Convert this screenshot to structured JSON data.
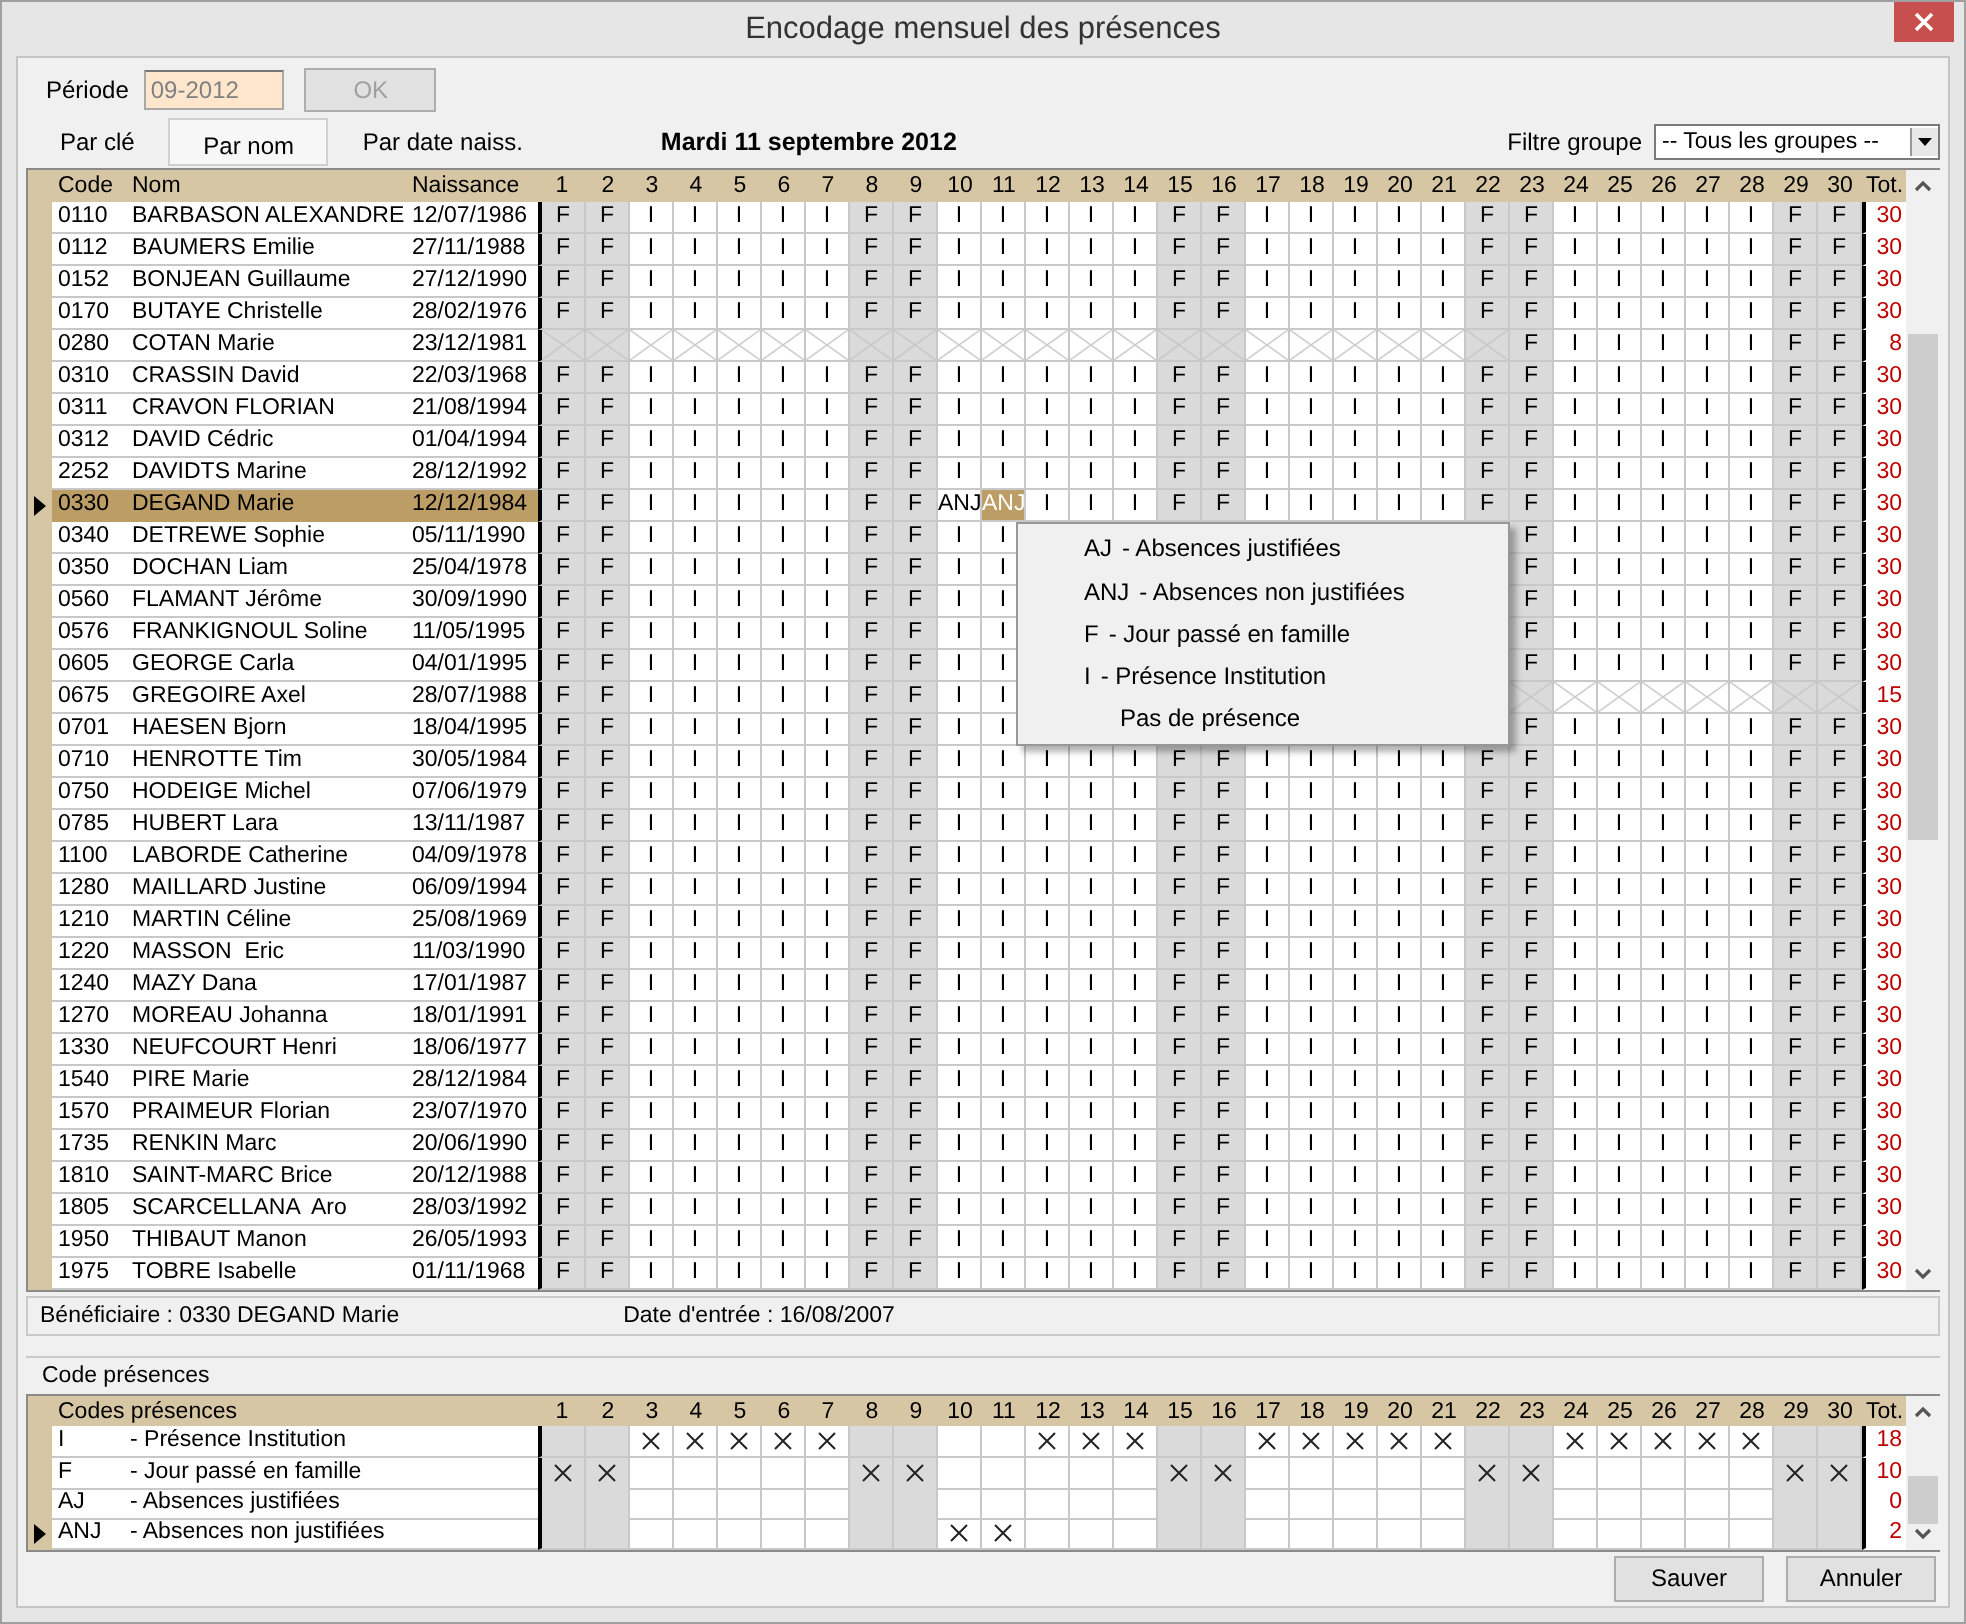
{
  "window": {
    "title": "Encodage mensuel des présences"
  },
  "period": {
    "label": "Période",
    "value": "09-2012",
    "disabled": true
  },
  "ok_button": {
    "label": "OK",
    "disabled": true
  },
  "sort_tabs": [
    {
      "label": "Par clé",
      "selected": false
    },
    {
      "label": "Par nom",
      "selected": true
    },
    {
      "label": "Par date naiss.",
      "selected": false
    }
  ],
  "current_date": "Mardi 11 septembre 2012",
  "group_filter": {
    "label": "Filtre groupe",
    "value": "-- Tous les groupes --"
  },
  "grid": {
    "columns": [
      "Code",
      "Nom",
      "Naissance"
    ],
    "total_label": "Tot.",
    "days": [
      {
        "label": "1",
        "weekend": true
      },
      {
        "label": "2",
        "weekend": true
      },
      {
        "label": "3",
        "weekend": false
      },
      {
        "label": "4",
        "weekend": false
      },
      {
        "label": "5",
        "weekend": false
      },
      {
        "label": "6",
        "weekend": false
      },
      {
        "label": "7",
        "weekend": false
      },
      {
        "label": "8",
        "weekend": true
      },
      {
        "label": "9",
        "weekend": true
      },
      {
        "label": "10",
        "weekend": false
      },
      {
        "label": "11",
        "weekend": false
      },
      {
        "label": "12",
        "weekend": false
      },
      {
        "label": "13",
        "weekend": false
      },
      {
        "label": "14",
        "weekend": false
      },
      {
        "label": "15",
        "weekend": true
      },
      {
        "label": "16",
        "weekend": true
      },
      {
        "label": "17",
        "weekend": false
      },
      {
        "label": "18",
        "weekend": false
      },
      {
        "label": "19",
        "weekend": false
      },
      {
        "label": "20",
        "weekend": false
      },
      {
        "label": "21",
        "weekend": false
      },
      {
        "label": "22",
        "weekend": true
      },
      {
        "label": "23",
        "weekend": true
      },
      {
        "label": "24",
        "weekend": false
      },
      {
        "label": "25",
        "weekend": false
      },
      {
        "label": "26",
        "weekend": false
      },
      {
        "label": "27",
        "weekend": false
      },
      {
        "label": "28",
        "weekend": false
      },
      {
        "label": "29",
        "weekend": true
      },
      {
        "label": "30",
        "weekend": true
      }
    ],
    "rows": [
      {
        "code": "0110",
        "name": "BARBASON ALEXANDRE",
        "birth": "12/07/1986",
        "selected": false,
        "total": "30",
        "cells": [
          "F",
          "F",
          "I",
          "I",
          "I",
          "I",
          "I",
          "F",
          "F",
          "I",
          "I",
          "I",
          "I",
          "I",
          "F",
          "F",
          "I",
          "I",
          "I",
          "I",
          "I",
          "F",
          "F",
          "I",
          "I",
          "I",
          "I",
          "I",
          "F",
          "F"
        ]
      },
      {
        "code": "0112",
        "name": "BAUMERS Emilie",
        "birth": "27/11/1988",
        "selected": false,
        "total": "30",
        "cells": [
          "F",
          "F",
          "I",
          "I",
          "I",
          "I",
          "I",
          "F",
          "F",
          "I",
          "I",
          "I",
          "I",
          "I",
          "F",
          "F",
          "I",
          "I",
          "I",
          "I",
          "I",
          "F",
          "F",
          "I",
          "I",
          "I",
          "I",
          "I",
          "F",
          "F"
        ]
      },
      {
        "code": "0152",
        "name": "BONJEAN Guillaume",
        "birth": "27/12/1990",
        "selected": false,
        "total": "30",
        "cells": [
          "F",
          "F",
          "I",
          "I",
          "I",
          "I",
          "I",
          "F",
          "F",
          "I",
          "I",
          "I",
          "I",
          "I",
          "F",
          "F",
          "I",
          "I",
          "I",
          "I",
          "I",
          "F",
          "F",
          "I",
          "I",
          "I",
          "I",
          "I",
          "F",
          "F"
        ]
      },
      {
        "code": "0170",
        "name": "BUTAYE Christelle",
        "birth": "28/02/1976",
        "selected": false,
        "total": "30",
        "cells": [
          "F",
          "F",
          "I",
          "I",
          "I",
          "I",
          "I",
          "F",
          "F",
          "I",
          "I",
          "I",
          "I",
          "I",
          "F",
          "F",
          "I",
          "I",
          "I",
          "I",
          "I",
          "F",
          "F",
          "I",
          "I",
          "I",
          "I",
          "I",
          "F",
          "F"
        ]
      },
      {
        "code": "0280",
        "name": "COTAN Marie",
        "birth": "23/12/1981",
        "selected": false,
        "total": "8",
        "cells": [
          null,
          null,
          null,
          null,
          null,
          null,
          null,
          null,
          null,
          null,
          null,
          null,
          null,
          null,
          null,
          null,
          null,
          null,
          null,
          null,
          null,
          null,
          "F",
          "I",
          "I",
          "I",
          "I",
          "I",
          "F",
          "F"
        ]
      },
      {
        "code": "0310",
        "name": "CRASSIN David",
        "birth": "22/03/1968",
        "selected": false,
        "total": "30",
        "cells": [
          "F",
          "F",
          "I",
          "I",
          "I",
          "I",
          "I",
          "F",
          "F",
          "I",
          "I",
          "I",
          "I",
          "I",
          "F",
          "F",
          "I",
          "I",
          "I",
          "I",
          "I",
          "F",
          "F",
          "I",
          "I",
          "I",
          "I",
          "I",
          "F",
          "F"
        ]
      },
      {
        "code": "0311",
        "name": "CRAVON FLORIAN",
        "birth": "21/08/1994",
        "selected": false,
        "total": "30",
        "cells": [
          "F",
          "F",
          "I",
          "I",
          "I",
          "I",
          "I",
          "F",
          "F",
          "I",
          "I",
          "I",
          "I",
          "I",
          "F",
          "F",
          "I",
          "I",
          "I",
          "I",
          "I",
          "F",
          "F",
          "I",
          "I",
          "I",
          "I",
          "I",
          "F",
          "F"
        ]
      },
      {
        "code": "0312",
        "name": "DAVID Cédric",
        "birth": "01/04/1994",
        "selected": false,
        "total": "30",
        "cells": [
          "F",
          "F",
          "I",
          "I",
          "I",
          "I",
          "I",
          "F",
          "F",
          "I",
          "I",
          "I",
          "I",
          "I",
          "F",
          "F",
          "I",
          "I",
          "I",
          "I",
          "I",
          "F",
          "F",
          "I",
          "I",
          "I",
          "I",
          "I",
          "F",
          "F"
        ]
      },
      {
        "code": "2252",
        "name": "DAVIDTS Marine",
        "birth": "28/12/1992",
        "selected": false,
        "total": "30",
        "cells": [
          "F",
          "F",
          "I",
          "I",
          "I",
          "I",
          "I",
          "F",
          "F",
          "I",
          "I",
          "I",
          "I",
          "I",
          "F",
          "F",
          "I",
          "I",
          "I",
          "I",
          "I",
          "F",
          "F",
          "I",
          "I",
          "I",
          "I",
          "I",
          "F",
          "F"
        ]
      },
      {
        "code": "0330",
        "name": "DEGAND Marie",
        "birth": "12/12/1984",
        "selected": true,
        "total": "30",
        "cells": [
          "F",
          "F",
          "I",
          "I",
          "I",
          "I",
          "I",
          "F",
          "F",
          "ANJ",
          {
            "value": "ANJ",
            "selected": true
          },
          "I",
          "I",
          "I",
          "F",
          "F",
          "I",
          "I",
          "I",
          "I",
          "I",
          "F",
          "F",
          "I",
          "I",
          "I",
          "I",
          "I",
          "F",
          "F"
        ]
      },
      {
        "code": "0340",
        "name": "DETREWE Sophie",
        "birth": "05/11/1990",
        "selected": false,
        "total": "30",
        "cells": [
          "F",
          "F",
          "I",
          "I",
          "I",
          "I",
          "I",
          "F",
          "F",
          "I",
          "I",
          null,
          null,
          null,
          null,
          null,
          null,
          null,
          null,
          null,
          null,
          null,
          "F",
          "I",
          "I",
          "I",
          "I",
          "I",
          "F",
          "F"
        ]
      },
      {
        "code": "0350",
        "name": "DOCHAN Liam",
        "birth": "25/04/1978",
        "selected": false,
        "total": "30",
        "cells": [
          "F",
          "F",
          "I",
          "I",
          "I",
          "I",
          "I",
          "F",
          "F",
          "I",
          "I",
          null,
          null,
          null,
          null,
          null,
          null,
          null,
          null,
          null,
          null,
          null,
          "F",
          "I",
          "I",
          "I",
          "I",
          "I",
          "F",
          "F"
        ]
      },
      {
        "code": "0560",
        "name": "FLAMANT Jérôme",
        "birth": "30/09/1990",
        "selected": false,
        "total": "30",
        "cells": [
          "F",
          "F",
          "I",
          "I",
          "I",
          "I",
          "I",
          "F",
          "F",
          "I",
          "I",
          null,
          null,
          null,
          null,
          null,
          null,
          null,
          null,
          null,
          null,
          null,
          "F",
          "I",
          "I",
          "I",
          "I",
          "I",
          "F",
          "F"
        ]
      },
      {
        "code": "0576",
        "name": "FRANKIGNOUL Soline",
        "birth": "11/05/1995",
        "selected": false,
        "total": "30",
        "cells": [
          "F",
          "F",
          "I",
          "I",
          "I",
          "I",
          "I",
          "F",
          "F",
          "I",
          "I",
          null,
          null,
          null,
          null,
          null,
          null,
          null,
          null,
          null,
          null,
          null,
          "F",
          "I",
          "I",
          "I",
          "I",
          "I",
          "F",
          "F"
        ]
      },
      {
        "code": "0605",
        "name": "GEORGE Carla",
        "birth": "04/01/1995",
        "selected": false,
        "total": "30",
        "cells": [
          "F",
          "F",
          "I",
          "I",
          "I",
          "I",
          "I",
          "F",
          "F",
          "I",
          "I",
          null,
          null,
          null,
          null,
          null,
          null,
          null,
          null,
          null,
          null,
          null,
          "F",
          "I",
          "I",
          "I",
          "I",
          "I",
          "F",
          "F"
        ]
      },
      {
        "code": "0675",
        "name": "GREGOIRE Axel",
        "birth": "28/07/1988",
        "selected": false,
        "total": "15",
        "cells": [
          "F",
          "F",
          "I",
          "I",
          "I",
          "I",
          "I",
          "F",
          "F",
          "I",
          "I",
          null,
          null,
          null,
          null,
          null,
          null,
          null,
          null,
          null,
          null,
          null,
          null,
          null,
          null,
          null,
          null,
          null,
          null,
          null
        ]
      },
      {
        "code": "0701",
        "name": "HAESEN Bjorn",
        "birth": "18/04/1995",
        "selected": false,
        "total": "30",
        "cells": [
          "F",
          "F",
          "I",
          "I",
          "I",
          "I",
          "I",
          "F",
          "F",
          "I",
          "I",
          null,
          null,
          null,
          null,
          null,
          null,
          null,
          null,
          null,
          null,
          null,
          "F",
          "I",
          "I",
          "I",
          "I",
          "I",
          "F",
          "F"
        ]
      },
      {
        "code": "0710",
        "name": "HENROTTE Tim",
        "birth": "30/05/1984",
        "selected": false,
        "total": "30",
        "cells": [
          "F",
          "F",
          "I",
          "I",
          "I",
          "I",
          "I",
          "F",
          "F",
          "I",
          "I",
          "I",
          "I",
          "I",
          "F",
          "F",
          "I",
          "I",
          "I",
          "I",
          "I",
          "F",
          "F",
          "I",
          "I",
          "I",
          "I",
          "I",
          "F",
          "F"
        ]
      },
      {
        "code": "0750",
        "name": "HODEIGE Michel",
        "birth": "07/06/1979",
        "selected": false,
        "total": "30",
        "cells": [
          "F",
          "F",
          "I",
          "I",
          "I",
          "I",
          "I",
          "F",
          "F",
          "I",
          "I",
          "I",
          "I",
          "I",
          "F",
          "F",
          "I",
          "I",
          "I",
          "I",
          "I",
          "F",
          "F",
          "I",
          "I",
          "I",
          "I",
          "I",
          "F",
          "F"
        ]
      },
      {
        "code": "0785",
        "name": "HUBERT Lara",
        "birth": "13/11/1987",
        "selected": false,
        "total": "30",
        "cells": [
          "F",
          "F",
          "I",
          "I",
          "I",
          "I",
          "I",
          "F",
          "F",
          "I",
          "I",
          "I",
          "I",
          "I",
          "F",
          "F",
          "I",
          "I",
          "I",
          "I",
          "I",
          "F",
          "F",
          "I",
          "I",
          "I",
          "I",
          "I",
          "F",
          "F"
        ]
      },
      {
        "code": "1100",
        "name": "LABORDE Catherine",
        "birth": "04/09/1978",
        "selected": false,
        "total": "30",
        "cells": [
          "F",
          "F",
          "I",
          "I",
          "I",
          "I",
          "I",
          "F",
          "F",
          "I",
          "I",
          "I",
          "I",
          "I",
          "F",
          "F",
          "I",
          "I",
          "I",
          "I",
          "I",
          "F",
          "F",
          "I",
          "I",
          "I",
          "I",
          "I",
          "F",
          "F"
        ]
      },
      {
        "code": "1280",
        "name": "MAILLARD Justine",
        "birth": "06/09/1994",
        "selected": false,
        "total": "30",
        "cells": [
          "F",
          "F",
          "I",
          "I",
          "I",
          "I",
          "I",
          "F",
          "F",
          "I",
          "I",
          "I",
          "I",
          "I",
          "F",
          "F",
          "I",
          "I",
          "I",
          "I",
          "I",
          "F",
          "F",
          "I",
          "I",
          "I",
          "I",
          "I",
          "F",
          "F"
        ]
      },
      {
        "code": "1210",
        "name": "MARTIN Céline",
        "birth": "25/08/1969",
        "selected": false,
        "total": "30",
        "cells": [
          "F",
          "F",
          "I",
          "I",
          "I",
          "I",
          "I",
          "F",
          "F",
          "I",
          "I",
          "I",
          "I",
          "I",
          "F",
          "F",
          "I",
          "I",
          "I",
          "I",
          "I",
          "F",
          "F",
          "I",
          "I",
          "I",
          "I",
          "I",
          "F",
          "F"
        ]
      },
      {
        "code": "1220",
        "name": "MASSON  Eric",
        "birth": "11/03/1990",
        "selected": false,
        "total": "30",
        "cells": [
          "F",
          "F",
          "I",
          "I",
          "I",
          "I",
          "I",
          "F",
          "F",
          "I",
          "I",
          "I",
          "I",
          "I",
          "F",
          "F",
          "I",
          "I",
          "I",
          "I",
          "I",
          "F",
          "F",
          "I",
          "I",
          "I",
          "I",
          "I",
          "F",
          "F"
        ]
      },
      {
        "code": "1240",
        "name": "MAZY Dana",
        "birth": "17/01/1987",
        "selected": false,
        "total": "30",
        "cells": [
          "F",
          "F",
          "I",
          "I",
          "I",
          "I",
          "I",
          "F",
          "F",
          "I",
          "I",
          "I",
          "I",
          "I",
          "F",
          "F",
          "I",
          "I",
          "I",
          "I",
          "I",
          "F",
          "F",
          "I",
          "I",
          "I",
          "I",
          "I",
          "F",
          "F"
        ]
      },
      {
        "code": "1270",
        "name": "MOREAU Johanna",
        "birth": "18/01/1991",
        "selected": false,
        "total": "30",
        "cells": [
          "F",
          "F",
          "I",
          "I",
          "I",
          "I",
          "I",
          "F",
          "F",
          "I",
          "I",
          "I",
          "I",
          "I",
          "F",
          "F",
          "I",
          "I",
          "I",
          "I",
          "I",
          "F",
          "F",
          "I",
          "I",
          "I",
          "I",
          "I",
          "F",
          "F"
        ]
      },
      {
        "code": "1330",
        "name": "NEUFCOURT Henri",
        "birth": "18/06/1977",
        "selected": false,
        "total": "30",
        "cells": [
          "F",
          "F",
          "I",
          "I",
          "I",
          "I",
          "I",
          "F",
          "F",
          "I",
          "I",
          "I",
          "I",
          "I",
          "F",
          "F",
          "I",
          "I",
          "I",
          "I",
          "I",
          "F",
          "F",
          "I",
          "I",
          "I",
          "I",
          "I",
          "F",
          "F"
        ]
      },
      {
        "code": "1540",
        "name": "PIRE Marie",
        "birth": "28/12/1984",
        "selected": false,
        "total": "30",
        "cells": [
          "F",
          "F",
          "I",
          "I",
          "I",
          "I",
          "I",
          "F",
          "F",
          "I",
          "I",
          "I",
          "I",
          "I",
          "F",
          "F",
          "I",
          "I",
          "I",
          "I",
          "I",
          "F",
          "F",
          "I",
          "I",
          "I",
          "I",
          "I",
          "F",
          "F"
        ]
      },
      {
        "code": "1570",
        "name": "PRAIMEUR Florian",
        "birth": "23/07/1970",
        "selected": false,
        "total": "30",
        "cells": [
          "F",
          "F",
          "I",
          "I",
          "I",
          "I",
          "I",
          "F",
          "F",
          "I",
          "I",
          "I",
          "I",
          "I",
          "F",
          "F",
          "I",
          "I",
          "I",
          "I",
          "I",
          "F",
          "F",
          "I",
          "I",
          "I",
          "I",
          "I",
          "F",
          "F"
        ]
      },
      {
        "code": "1735",
        "name": "RENKIN Marc",
        "birth": "20/06/1990",
        "selected": false,
        "total": "30",
        "cells": [
          "F",
          "F",
          "I",
          "I",
          "I",
          "I",
          "I",
          "F",
          "F",
          "I",
          "I",
          "I",
          "I",
          "I",
          "F",
          "F",
          "I",
          "I",
          "I",
          "I",
          "I",
          "F",
          "F",
          "I",
          "I",
          "I",
          "I",
          "I",
          "F",
          "F"
        ]
      },
      {
        "code": "1810",
        "name": "SAINT-MARC Brice",
        "birth": "20/12/1988",
        "selected": false,
        "total": "30",
        "cells": [
          "F",
          "F",
          "I",
          "I",
          "I",
          "I",
          "I",
          "F",
          "F",
          "I",
          "I",
          "I",
          "I",
          "I",
          "F",
          "F",
          "I",
          "I",
          "I",
          "I",
          "I",
          "F",
          "F",
          "I",
          "I",
          "I",
          "I",
          "I",
          "F",
          "F"
        ]
      },
      {
        "code": "1805",
        "name": "SCARCELLANA  Aro",
        "birth": "28/03/1992",
        "selected": false,
        "total": "30",
        "cells": [
          "F",
          "F",
          "I",
          "I",
          "I",
          "I",
          "I",
          "F",
          "F",
          "I",
          "I",
          "I",
          "I",
          "I",
          "F",
          "F",
          "I",
          "I",
          "I",
          "I",
          "I",
          "F",
          "F",
          "I",
          "I",
          "I",
          "I",
          "I",
          "F",
          "F"
        ]
      },
      {
        "code": "1950",
        "name": "THIBAUT Manon",
        "birth": "26/05/1993",
        "selected": false,
        "total": "30",
        "cells": [
          "F",
          "F",
          "I",
          "I",
          "I",
          "I",
          "I",
          "F",
          "F",
          "I",
          "I",
          "I",
          "I",
          "I",
          "F",
          "F",
          "I",
          "I",
          "I",
          "I",
          "I",
          "F",
          "F",
          "I",
          "I",
          "I",
          "I",
          "I",
          "F",
          "F"
        ]
      },
      {
        "code": "1975",
        "name": "TOBRE Isabelle",
        "birth": "01/11/1968",
        "selected": false,
        "total": "30",
        "cells": [
          "F",
          "F",
          "I",
          "I",
          "I",
          "I",
          "I",
          "F",
          "F",
          "I",
          "I",
          "I",
          "I",
          "I",
          "F",
          "F",
          "I",
          "I",
          "I",
          "I",
          "I",
          "F",
          "F",
          "I",
          "I",
          "I",
          "I",
          "I",
          "F",
          "F"
        ]
      }
    ]
  },
  "context_menu": {
    "items": [
      {
        "code": "AJ",
        "label": "- Absences justifiées"
      },
      {
        "code": "ANJ",
        "label": "- Absences non justifiées"
      },
      {
        "code": "F",
        "label": "- Jour passé en famille"
      },
      {
        "code": "I",
        "label": "- Présence Institution"
      },
      {
        "label": "Pas de présence"
      }
    ]
  },
  "info": {
    "beneficiary": "Bénéficiaire : 0330 DEGAND Marie",
    "entry_date": "Date d'entrée : 16/08/2007"
  },
  "codes_panel": {
    "title": "Code présences",
    "header": "Codes présences",
    "total_label": "Tot.",
    "days": [
      {
        "label": "1",
        "weekend": true
      },
      {
        "label": "2",
        "weekend": true
      },
      {
        "label": "3",
        "weekend": false
      },
      {
        "label": "4",
        "weekend": false
      },
      {
        "label": "5",
        "weekend": false
      },
      {
        "label": "6",
        "weekend": false
      },
      {
        "label": "7",
        "weekend": false
      },
      {
        "label": "8",
        "weekend": true
      },
      {
        "label": "9",
        "weekend": true
      },
      {
        "label": "10",
        "weekend": false
      },
      {
        "label": "11",
        "weekend": false
      },
      {
        "label": "12",
        "weekend": false
      },
      {
        "label": "13",
        "weekend": false
      },
      {
        "label": "14",
        "weekend": false
      },
      {
        "label": "15",
        "weekend": true
      },
      {
        "label": "16",
        "weekend": true
      },
      {
        "label": "17",
        "weekend": false
      },
      {
        "label": "18",
        "weekend": false
      },
      {
        "label": "19",
        "weekend": false
      },
      {
        "label": "20",
        "weekend": false
      },
      {
        "label": "21",
        "weekend": false
      },
      {
        "label": "22",
        "weekend": true
      },
      {
        "label": "23",
        "weekend": true
      },
      {
        "label": "24",
        "weekend": false
      },
      {
        "label": "25",
        "weekend": false
      },
      {
        "label": "26",
        "weekend": false
      },
      {
        "label": "27",
        "weekend": false
      },
      {
        "label": "28",
        "weekend": false
      },
      {
        "label": "29",
        "weekend": true
      },
      {
        "label": "30",
        "weekend": true
      }
    ],
    "rows": [
      {
        "code": "I",
        "label": "- Présence Institution",
        "selected": false,
        "total": "18",
        "marks": [
          false,
          false,
          true,
          true,
          true,
          true,
          true,
          false,
          false,
          false,
          false,
          true,
          true,
          true,
          false,
          false,
          true,
          true,
          true,
          true,
          true,
          false,
          false,
          true,
          true,
          true,
          true,
          true,
          false,
          false
        ]
      },
      {
        "code": "F",
        "label": "- Jour passé en famille",
        "selected": false,
        "total": "10",
        "marks": [
          true,
          true,
          false,
          false,
          false,
          false,
          false,
          true,
          true,
          false,
          false,
          false,
          false,
          false,
          true,
          true,
          false,
          false,
          false,
          false,
          false,
          true,
          true,
          false,
          false,
          false,
          false,
          false,
          true,
          true
        ]
      },
      {
        "code": "AJ",
        "label": "- Absences justifiées",
        "selected": false,
        "total": "0",
        "marks": [
          false,
          false,
          false,
          false,
          false,
          false,
          false,
          false,
          false,
          false,
          false,
          false,
          false,
          false,
          false,
          false,
          false,
          false,
          false,
          false,
          false,
          false,
          false,
          false,
          false,
          false,
          false,
          false,
          false,
          false
        ]
      },
      {
        "code": "ANJ",
        "label": "- Absences non justifiées",
        "selected": true,
        "total": "2",
        "marks": [
          false,
          false,
          false,
          false,
          false,
          false,
          false,
          false,
          false,
          true,
          true,
          false,
          false,
          false,
          false,
          false,
          false,
          false,
          false,
          false,
          false,
          false,
          false,
          false,
          false,
          false,
          false,
          false,
          false,
          false
        ]
      }
    ]
  },
  "buttons": [
    {
      "label": "Sauver"
    },
    {
      "label": "Annuler"
    }
  ]
}
